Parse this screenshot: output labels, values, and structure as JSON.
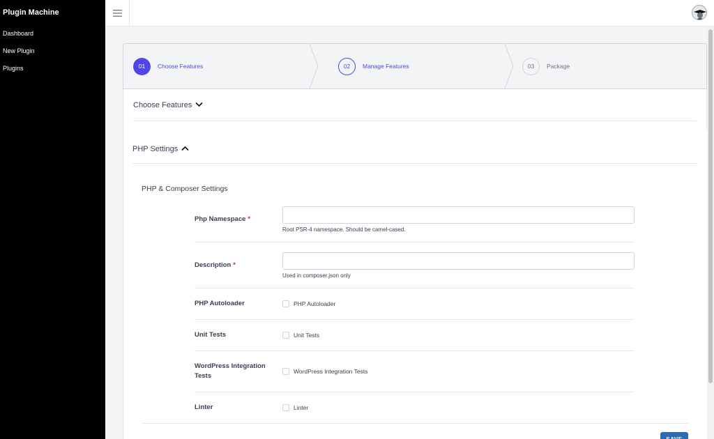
{
  "sidebar": {
    "brand": "Plugin Machine",
    "items": [
      {
        "label": "Dashboard"
      },
      {
        "label": "New Plugin"
      },
      {
        "label": "Plugins"
      }
    ]
  },
  "topbar": {
    "menu_icon": "hamburger-icon",
    "avatar_icon": "user-avatar"
  },
  "stepper": {
    "steps": [
      {
        "number": "01",
        "label": "Choose Features",
        "state": "active"
      },
      {
        "number": "02",
        "label": "Manage Features",
        "state": "current"
      },
      {
        "number": "03",
        "label": "Package",
        "state": "upcoming"
      }
    ]
  },
  "sections": {
    "choose_features": {
      "title": "Choose Features",
      "icon": "chevron-down-icon"
    },
    "php_settings": {
      "title": "PHP Settings",
      "icon": "chevron-up-icon"
    }
  },
  "form": {
    "title": "PHP & Composer Settings",
    "fields": {
      "namespace": {
        "label": "Php Namespace",
        "required": "*",
        "value": "",
        "help": "Root PSR-4 namespace. Should be camel-cased."
      },
      "description": {
        "label": "Description",
        "required": "*",
        "value": "",
        "help": "Used in composer.json only"
      },
      "autoloader": {
        "label": "PHP Autoloader",
        "checkbox_label": "PHP Autoloader",
        "checked": false
      },
      "unit_tests": {
        "label": "Unit Tests",
        "checkbox_label": "Unit Tests",
        "checked": false
      },
      "wp_integration": {
        "label": "WordPress Integration Tests",
        "checkbox_label": "WordPress Integration Tests",
        "checked": false
      },
      "linter": {
        "label": "Linter",
        "checkbox_label": "Linter",
        "checked": false
      }
    },
    "save_label": "SAVE"
  },
  "colors": {
    "accent": "#4f46e5",
    "sidebar_bg": "#000000",
    "save_button": "#2b6cb0",
    "required": "#dc2626"
  }
}
